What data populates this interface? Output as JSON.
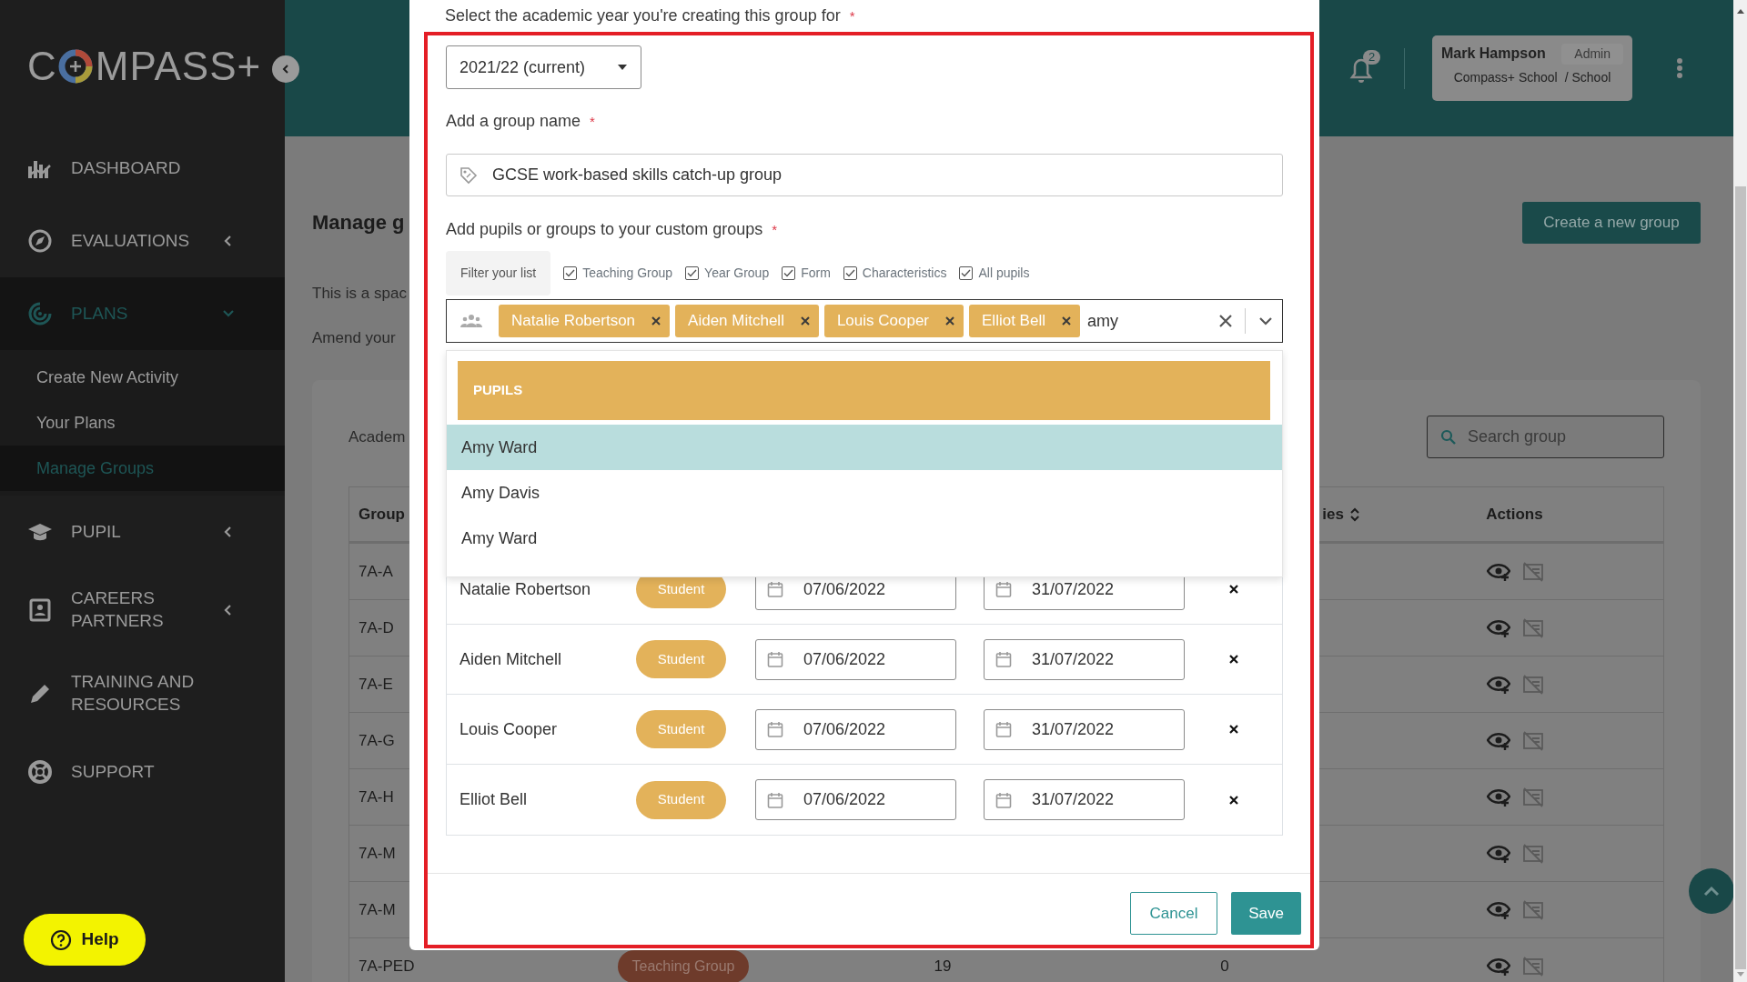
{
  "sidebar": {
    "logo": {
      "lead": "C",
      "tail": "MPASS+"
    },
    "nav": [
      {
        "label": "DASHBOARD",
        "selected": false
      },
      {
        "label": "EVALUATIONS",
        "selected": false,
        "expanded": false
      },
      {
        "label": "PLANS",
        "selected": true,
        "expanded": true,
        "children": [
          {
            "label": "Create New Activity",
            "selected": false
          },
          {
            "label": "Your Plans",
            "selected": false
          },
          {
            "label": "Manage Groups",
            "selected": true
          }
        ]
      },
      {
        "label": "PUPIL",
        "selected": false,
        "expanded": false
      },
      {
        "label": "CAREERS PARTNERS",
        "selected": false,
        "expanded": false
      },
      {
        "label": "TRAINING AND RESOURCES",
        "selected": false
      },
      {
        "label": "SUPPORT",
        "selected": false
      }
    ],
    "help": "Help"
  },
  "header": {
    "notifications": "2",
    "user": {
      "name": "Mark Hampson",
      "role": "Admin",
      "school": "Compass+ School",
      "scope": "/ School"
    }
  },
  "page": {
    "title": "Manage g",
    "create_button": "Create a new group",
    "intro": [
      "This is a spac",
      "Amend your"
    ],
    "filter_label": "Academ",
    "search": {
      "placeholder": "Search group"
    },
    "table": {
      "columns": [
        "Group",
        "ies",
        "Actions"
      ],
      "rows": [
        {
          "group": "7A-A"
        },
        {
          "group": "7A-D"
        },
        {
          "group": "7A-E"
        },
        {
          "group": "7A-G"
        },
        {
          "group": "7A-H"
        },
        {
          "group": "7A-M"
        },
        {
          "group": "7A-M"
        },
        {
          "group": "7A-PED",
          "type": "Teaching Group",
          "column_3": "19",
          "column_4": "0"
        }
      ]
    }
  },
  "modal": {
    "year": {
      "label": "Select the academic year you're creating this group for",
      "required": "*",
      "value": "2021/22 (current)"
    },
    "name": {
      "label": "Add a group name",
      "required": "*",
      "value": "GCSE work-based skills catch-up group"
    },
    "pupils": {
      "label": "Add pupils or groups to your custom groups",
      "required": "*",
      "filter_label": "Filter your list",
      "filters": [
        {
          "label": "Teaching Group",
          "checked": true
        },
        {
          "label": "Year Group",
          "checked": true
        },
        {
          "label": "Form",
          "checked": true
        },
        {
          "label": "Characteristics",
          "checked": true
        },
        {
          "label": "All pupils",
          "checked": true
        }
      ],
      "tags": [
        "Natalie Robertson",
        "Aiden Mitchell",
        "Louis Cooper",
        "Elliot Bell"
      ],
      "query": "amy",
      "dropdown": {
        "header": "PUPILS",
        "options": [
          {
            "label": "Amy Ward",
            "selected": true
          },
          {
            "label": "Amy Davis",
            "selected": false
          },
          {
            "label": "Amy Ward",
            "selected": false
          }
        ]
      },
      "members": [
        {
          "name": "Natalie Robertson",
          "role": "Student",
          "start": "07/06/2022",
          "end": "31/07/2022"
        },
        {
          "name": "Aiden Mitchell",
          "role": "Student",
          "start": "07/06/2022",
          "end": "31/07/2022"
        },
        {
          "name": "Louis Cooper",
          "role": "Student",
          "start": "07/06/2022",
          "end": "31/07/2022"
        },
        {
          "name": "Elliot Bell",
          "role": "Student",
          "start": "07/06/2022",
          "end": "31/07/2022"
        }
      ]
    },
    "buttons": [
      {
        "label": "Cancel",
        "kind": "secondary"
      },
      {
        "label": "Save",
        "kind": "primary"
      }
    ]
  }
}
